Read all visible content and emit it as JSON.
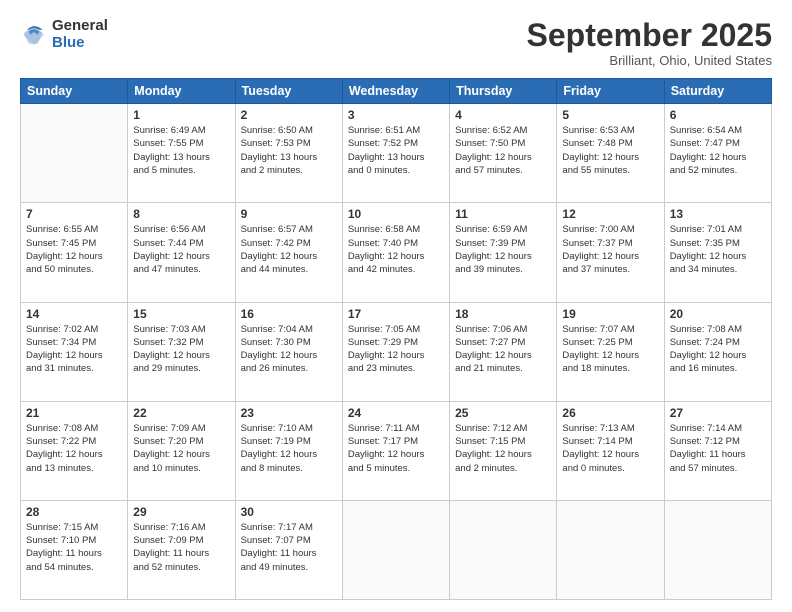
{
  "logo": {
    "general": "General",
    "blue": "Blue"
  },
  "header": {
    "month": "September 2025",
    "location": "Brilliant, Ohio, United States"
  },
  "weekdays": [
    "Sunday",
    "Monday",
    "Tuesday",
    "Wednesday",
    "Thursday",
    "Friday",
    "Saturday"
  ],
  "weeks": [
    [
      {
        "day": "",
        "info": ""
      },
      {
        "day": "1",
        "info": "Sunrise: 6:49 AM\nSunset: 7:55 PM\nDaylight: 13 hours\nand 5 minutes."
      },
      {
        "day": "2",
        "info": "Sunrise: 6:50 AM\nSunset: 7:53 PM\nDaylight: 13 hours\nand 2 minutes."
      },
      {
        "day": "3",
        "info": "Sunrise: 6:51 AM\nSunset: 7:52 PM\nDaylight: 13 hours\nand 0 minutes."
      },
      {
        "day": "4",
        "info": "Sunrise: 6:52 AM\nSunset: 7:50 PM\nDaylight: 12 hours\nand 57 minutes."
      },
      {
        "day": "5",
        "info": "Sunrise: 6:53 AM\nSunset: 7:48 PM\nDaylight: 12 hours\nand 55 minutes."
      },
      {
        "day": "6",
        "info": "Sunrise: 6:54 AM\nSunset: 7:47 PM\nDaylight: 12 hours\nand 52 minutes."
      }
    ],
    [
      {
        "day": "7",
        "info": "Sunrise: 6:55 AM\nSunset: 7:45 PM\nDaylight: 12 hours\nand 50 minutes."
      },
      {
        "day": "8",
        "info": "Sunrise: 6:56 AM\nSunset: 7:44 PM\nDaylight: 12 hours\nand 47 minutes."
      },
      {
        "day": "9",
        "info": "Sunrise: 6:57 AM\nSunset: 7:42 PM\nDaylight: 12 hours\nand 44 minutes."
      },
      {
        "day": "10",
        "info": "Sunrise: 6:58 AM\nSunset: 7:40 PM\nDaylight: 12 hours\nand 42 minutes."
      },
      {
        "day": "11",
        "info": "Sunrise: 6:59 AM\nSunset: 7:39 PM\nDaylight: 12 hours\nand 39 minutes."
      },
      {
        "day": "12",
        "info": "Sunrise: 7:00 AM\nSunset: 7:37 PM\nDaylight: 12 hours\nand 37 minutes."
      },
      {
        "day": "13",
        "info": "Sunrise: 7:01 AM\nSunset: 7:35 PM\nDaylight: 12 hours\nand 34 minutes."
      }
    ],
    [
      {
        "day": "14",
        "info": "Sunrise: 7:02 AM\nSunset: 7:34 PM\nDaylight: 12 hours\nand 31 minutes."
      },
      {
        "day": "15",
        "info": "Sunrise: 7:03 AM\nSunset: 7:32 PM\nDaylight: 12 hours\nand 29 minutes."
      },
      {
        "day": "16",
        "info": "Sunrise: 7:04 AM\nSunset: 7:30 PM\nDaylight: 12 hours\nand 26 minutes."
      },
      {
        "day": "17",
        "info": "Sunrise: 7:05 AM\nSunset: 7:29 PM\nDaylight: 12 hours\nand 23 minutes."
      },
      {
        "day": "18",
        "info": "Sunrise: 7:06 AM\nSunset: 7:27 PM\nDaylight: 12 hours\nand 21 minutes."
      },
      {
        "day": "19",
        "info": "Sunrise: 7:07 AM\nSunset: 7:25 PM\nDaylight: 12 hours\nand 18 minutes."
      },
      {
        "day": "20",
        "info": "Sunrise: 7:08 AM\nSunset: 7:24 PM\nDaylight: 12 hours\nand 16 minutes."
      }
    ],
    [
      {
        "day": "21",
        "info": "Sunrise: 7:08 AM\nSunset: 7:22 PM\nDaylight: 12 hours\nand 13 minutes."
      },
      {
        "day": "22",
        "info": "Sunrise: 7:09 AM\nSunset: 7:20 PM\nDaylight: 12 hours\nand 10 minutes."
      },
      {
        "day": "23",
        "info": "Sunrise: 7:10 AM\nSunset: 7:19 PM\nDaylight: 12 hours\nand 8 minutes."
      },
      {
        "day": "24",
        "info": "Sunrise: 7:11 AM\nSunset: 7:17 PM\nDaylight: 12 hours\nand 5 minutes."
      },
      {
        "day": "25",
        "info": "Sunrise: 7:12 AM\nSunset: 7:15 PM\nDaylight: 12 hours\nand 2 minutes."
      },
      {
        "day": "26",
        "info": "Sunrise: 7:13 AM\nSunset: 7:14 PM\nDaylight: 12 hours\nand 0 minutes."
      },
      {
        "day": "27",
        "info": "Sunrise: 7:14 AM\nSunset: 7:12 PM\nDaylight: 11 hours\nand 57 minutes."
      }
    ],
    [
      {
        "day": "28",
        "info": "Sunrise: 7:15 AM\nSunset: 7:10 PM\nDaylight: 11 hours\nand 54 minutes."
      },
      {
        "day": "29",
        "info": "Sunrise: 7:16 AM\nSunset: 7:09 PM\nDaylight: 11 hours\nand 52 minutes."
      },
      {
        "day": "30",
        "info": "Sunrise: 7:17 AM\nSunset: 7:07 PM\nDaylight: 11 hours\nand 49 minutes."
      },
      {
        "day": "",
        "info": ""
      },
      {
        "day": "",
        "info": ""
      },
      {
        "day": "",
        "info": ""
      },
      {
        "day": "",
        "info": ""
      }
    ]
  ]
}
